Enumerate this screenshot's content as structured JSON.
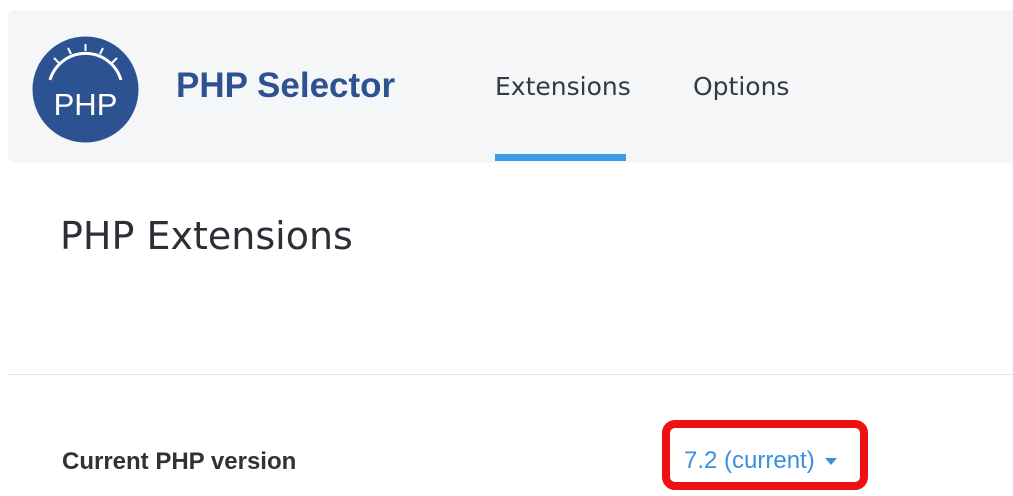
{
  "header": {
    "logo_text": "PHP",
    "app_title": "PHP Selector",
    "tabs": [
      {
        "label": "Extensions",
        "active": true
      },
      {
        "label": "Options",
        "active": false
      }
    ]
  },
  "main": {
    "page_title": "PHP Extensions",
    "current_version": {
      "label": "Current PHP version",
      "selected_value": "7.2 (current)"
    }
  },
  "colors": {
    "brand_blue": "#2d5291",
    "accent_blue": "#3a9ee6",
    "highlight_red": "#ee1111",
    "header_bg": "#f5f6f8"
  },
  "icons": {
    "logo": "php-gauge-logo-icon",
    "dropdown": "caret-down-icon"
  }
}
